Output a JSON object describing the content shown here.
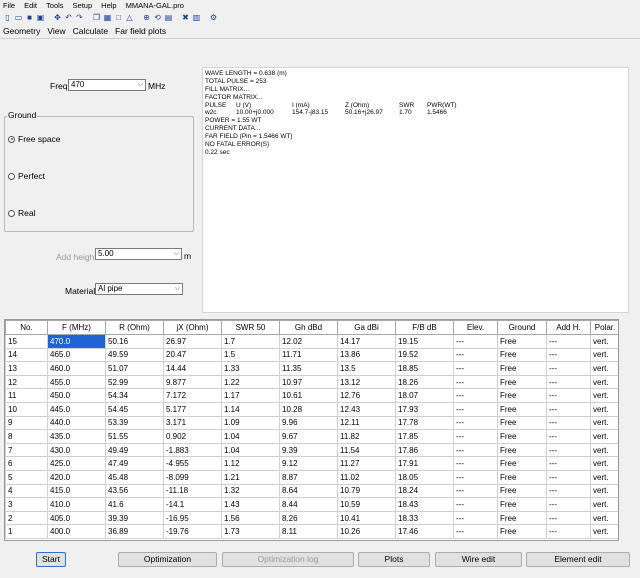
{
  "app": {
    "title": "MMANA-GAL.pro"
  },
  "menu": [
    "File",
    "Edit",
    "Tools",
    "Setup",
    "Help"
  ],
  "toolbar_icons": [
    "new-file-icon",
    "open-folder-icon",
    "save-icon",
    "save-as-icon",
    "sep",
    "move-icon",
    "undo-icon",
    "redo-icon",
    "sep",
    "copy-icon",
    "table-icon",
    "rect-icon",
    "triangle-icon",
    "sep",
    "zoom-icon",
    "rotate-icon",
    "grid-icon",
    "sep",
    "tools-icon",
    "chart-icon",
    "sep",
    "settings-icon"
  ],
  "tabs": [
    {
      "label": "Geometry",
      "active": false
    },
    {
      "label": "View",
      "active": false
    },
    {
      "label": "Calculate",
      "active": true
    },
    {
      "label": "Far field plots",
      "active": false
    }
  ],
  "freq": {
    "label": "Freq",
    "value": "470",
    "unit": "MHz"
  },
  "ground": {
    "title": "Ground",
    "options": [
      {
        "label": "Free space",
        "selected": true
      },
      {
        "label": "Perfect",
        "selected": false
      },
      {
        "label": "Real",
        "selected": false
      }
    ]
  },
  "add_height": {
    "label": "Add height",
    "value": "5.00",
    "unit": "m"
  },
  "material": {
    "label": "Material",
    "value": "Al pipe"
  },
  "output": {
    "lines": [
      "WAVE LENGTH = 0.638 (m)",
      "TOTAL PULSE = 253",
      "FILL MATRIX...",
      "FACTOR MATRIX..."
    ],
    "pulse_header": [
      "PULSE",
      "U (V)",
      "I (mA)",
      "Z (Ohm)",
      "SWR",
      "PWR(WT)"
    ],
    "pulse_row": [
      "w2c",
      "10.00+j0.000",
      "154.7-j83.15",
      "50.16+j26.97",
      "1.70",
      "1.5466"
    ],
    "lines2": [
      "POWER = 1.55  WT",
      "CURRENT DATA...",
      "FAR FIELD (Pin = 1.5466 WT)",
      "NO FATAL ERROR(S)",
      "0.22 sec"
    ]
  },
  "table": {
    "headers": [
      "No.",
      "F (MHz)",
      "R (Ohm)",
      "jX (Ohm)",
      "SWR 50",
      "Gh dBd",
      "Ga dBi",
      "F/B dB",
      "Elev.",
      "Ground",
      "Add H.",
      "Polar."
    ],
    "rows": [
      [
        "15",
        "470.0",
        "50.16",
        "26.97",
        "1.7",
        "12.02",
        "14.17",
        "19.15",
        "---",
        "Free",
        "---",
        "vert."
      ],
      [
        "14",
        "465.0",
        "49.59",
        "20.47",
        "1.5",
        "11.71",
        "13.86",
        "19.52",
        "---",
        "Free",
        "---",
        "vert."
      ],
      [
        "13",
        "460.0",
        "51.07",
        "14.44",
        "1.33",
        "11.35",
        "13.5",
        "18.85",
        "---",
        "Free",
        "---",
        "vert."
      ],
      [
        "12",
        "455.0",
        "52.99",
        "9.877",
        "1.22",
        "10.97",
        "13.12",
        "18.26",
        "---",
        "Free",
        "---",
        "vert."
      ],
      [
        "11",
        "450.0",
        "54.34",
        "7.172",
        "1.17",
        "10.61",
        "12.76",
        "18.07",
        "---",
        "Free",
        "---",
        "vert."
      ],
      [
        "10",
        "445.0",
        "54.45",
        "5.177",
        "1.14",
        "10.28",
        "12.43",
        "17.93",
        "---",
        "Free",
        "---",
        "vert."
      ],
      [
        "9",
        "440.0",
        "53.39",
        "3.171",
        "1.09",
        "9.96",
        "12.11",
        "17.78",
        "---",
        "Free",
        "---",
        "vert."
      ],
      [
        "8",
        "435.0",
        "51.55",
        "0.902",
        "1.04",
        "9.67",
        "11.82",
        "17.85",
        "---",
        "Free",
        "---",
        "vert."
      ],
      [
        "7",
        "430.0",
        "49.49",
        "-1.883",
        "1.04",
        "9.39",
        "11.54",
        "17.86",
        "---",
        "Free",
        "---",
        "vert."
      ],
      [
        "6",
        "425.0",
        "47.49",
        "-4.955",
        "1.12",
        "9.12",
        "11.27",
        "17.91",
        "---",
        "Free",
        "---",
        "vert."
      ],
      [
        "5",
        "420.0",
        "45.48",
        "-8.099",
        "1.21",
        "8.87",
        "11.02",
        "18.05",
        "---",
        "Free",
        "---",
        "vert."
      ],
      [
        "4",
        "415.0",
        "43.56",
        "-11.18",
        "1.32",
        "8.64",
        "10.79",
        "18.24",
        "---",
        "Free",
        "---",
        "vert."
      ],
      [
        "3",
        "410.0",
        "41.6",
        "-14.1",
        "1.43",
        "8.44",
        "10.59",
        "18.43",
        "---",
        "Free",
        "---",
        "vert."
      ],
      [
        "2",
        "405.0",
        "39.39",
        "-16.95",
        "1.56",
        "8.26",
        "10.41",
        "18.33",
        "---",
        "Free",
        "---",
        "vert."
      ],
      [
        "1",
        "400.0",
        "36.89",
        "-19.76",
        "1.73",
        "8.11",
        "10.26",
        "17.46",
        "---",
        "Free",
        "---",
        "vert."
      ]
    ]
  },
  "buttons": {
    "start": "Start",
    "optimization": "Optimization",
    "optimization_log": "Optimization log",
    "plots": "Plots",
    "wire_edit": "Wire edit",
    "element_edit": "Element edit"
  }
}
